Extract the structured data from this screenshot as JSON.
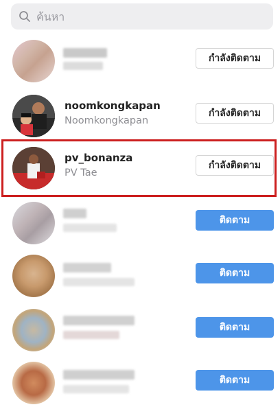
{
  "search": {
    "placeholder": "ค้นหา",
    "icon": "search-icon"
  },
  "colors": {
    "follow_button": "#4d95e9",
    "highlight_border": "#cc1f1f"
  },
  "users": [
    {
      "username": "",
      "fullname": "",
      "button_label": "กำลังติดตาม",
      "following": true,
      "blurred": true
    },
    {
      "username": "noomkongkapan",
      "fullname": "Noomkongkapan",
      "button_label": "กำลังติดตาม",
      "following": true,
      "blurred": false
    },
    {
      "username": "pv_bonanza",
      "fullname": "PV Tae",
      "button_label": "กำลังติดตาม",
      "following": true,
      "blurred": false,
      "highlighted": true
    },
    {
      "username": "",
      "fullname": "",
      "button_label": "ติดตาม",
      "following": false,
      "blurred": true
    },
    {
      "username": "",
      "fullname": "",
      "button_label": "ติดตาม",
      "following": false,
      "blurred": true
    },
    {
      "username": "",
      "fullname": "",
      "button_label": "ติดตาม",
      "following": false,
      "blurred": true
    },
    {
      "username": "",
      "fullname": "",
      "button_label": "ติดตาม",
      "following": false,
      "blurred": true
    }
  ]
}
